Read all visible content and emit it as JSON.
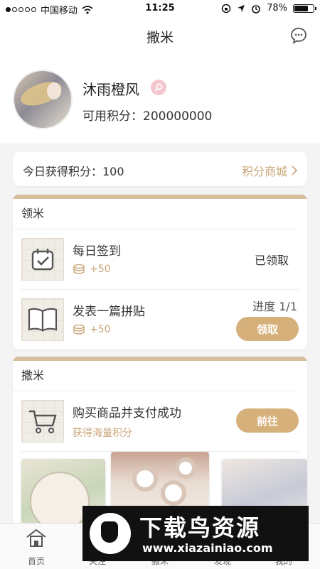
{
  "status_bar": {
    "carrier": "中国移动",
    "time": "11:25",
    "battery": "78%",
    "battery_level": 0.78
  },
  "nav": {
    "title": "撒米",
    "message_icon": "chat-bubble-icon"
  },
  "profile": {
    "username": "沐雨橙风",
    "points_label": "可用积分：",
    "points_value": "200000000"
  },
  "today": {
    "label": "今日获得积分：100",
    "link": "积分商城"
  },
  "earn_section": {
    "title": "领米",
    "tasks": [
      {
        "name": "每日签到",
        "reward": "+50",
        "status": "已领取",
        "icon": "calendar-check-icon"
      },
      {
        "name": "发表一篇拼贴",
        "reward": "+50",
        "progress": "进度  1/1",
        "button": "领取",
        "icon": "open-book-icon"
      }
    ]
  },
  "spend_section": {
    "title": "撒米",
    "tasks": [
      {
        "name": "购买商品并支付成功",
        "subtitle": "获得海量积分",
        "button": "前往",
        "icon": "shopping-cart-icon"
      }
    ]
  },
  "tabbar": {
    "items": [
      {
        "label": "首页",
        "icon": "home-icon"
      },
      {
        "label": "关注",
        "icon": "follow-icon"
      },
      {
        "label": "撒米",
        "icon": "rice-icon"
      },
      {
        "label": "发现",
        "icon": "discover-icon"
      },
      {
        "label": "我的",
        "icon": "profile-icon"
      }
    ]
  },
  "watermark": {
    "title": "下载鸟资源",
    "url": "www.xiazainiao.com"
  },
  "colors": {
    "accent": "#d6b07a",
    "link": "#c9a678",
    "card_top": "#d7bf9d"
  }
}
